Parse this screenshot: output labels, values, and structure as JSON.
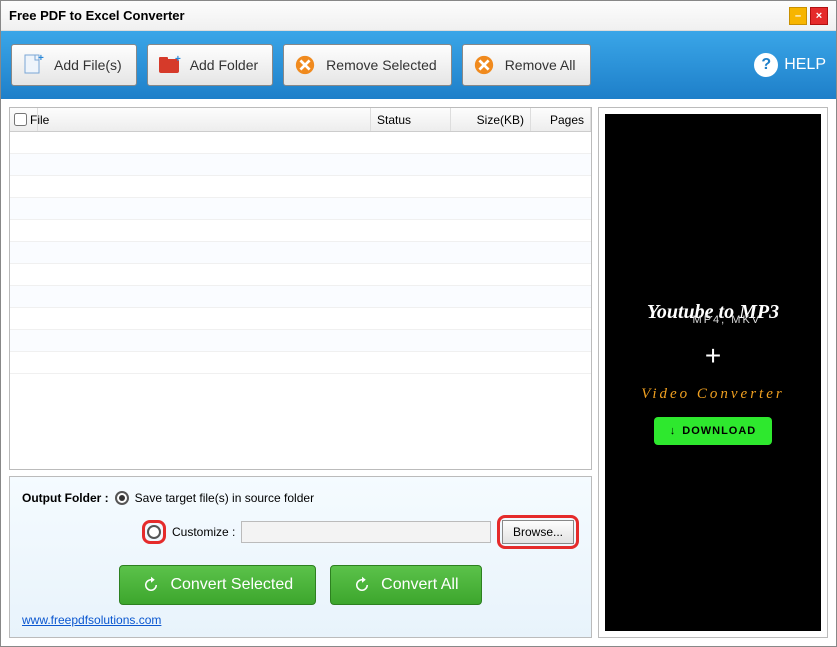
{
  "window": {
    "title": "Free PDF to Excel Converter"
  },
  "toolbar": {
    "add_files": "Add File(s)",
    "add_folder": "Add Folder",
    "remove_selected": "Remove Selected",
    "remove_all": "Remove All",
    "help": "HELP"
  },
  "grid": {
    "columns": {
      "file": "File",
      "status": "Status",
      "size": "Size(KB)",
      "pages": "Pages"
    }
  },
  "output": {
    "label": "Output Folder :",
    "save_source": "Save target file(s) in source folder",
    "customize": "Customize :",
    "browse": "Browse...",
    "path": ""
  },
  "convert": {
    "selected": "Convert Selected",
    "all": "Convert All"
  },
  "footer": {
    "link": "www.freepdfsolutions.com"
  },
  "ad": {
    "title": "Youtube to MP3",
    "subtitle": "MP4, MKV",
    "plus": "+",
    "videoconv": "Video Converter",
    "download": "DOWNLOAD"
  }
}
